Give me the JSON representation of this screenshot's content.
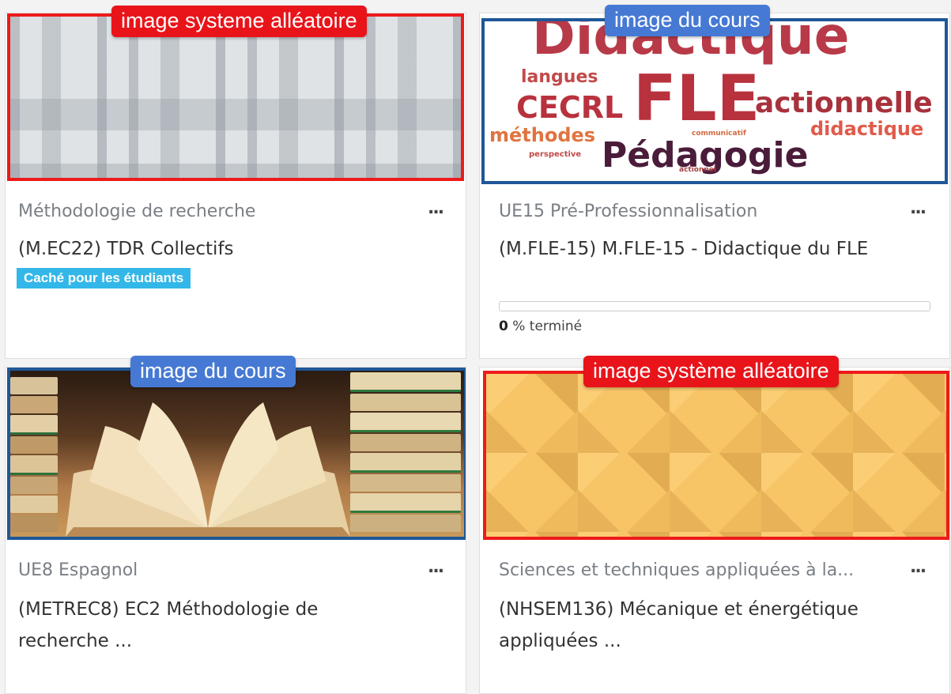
{
  "courses": [
    {
      "overlay_label": "image systeme alléatoire",
      "overlay_color": "#e8141a",
      "image_kind": "system-pattern",
      "category": "Méthodologie de recherche",
      "title": "(M.EC22) TDR Collectifs",
      "badge": "Caché pour les étudiants",
      "menu": "..."
    },
    {
      "overlay_label": "image du cours",
      "overlay_color": "#4679d3",
      "image_kind": "course-image",
      "category": "UE15 Pré-Professionnalisation",
      "title": "(M.FLE-15) M.FLE-15 - Didactique du FLE",
      "progress_percent": 0,
      "progress_value": "0",
      "progress_suffix": " % terminé",
      "menu": "...",
      "word_cloud": {
        "w1": "Didactique",
        "w2": "langues",
        "w3": "CECRL",
        "w4": "FLE",
        "w5": "actionnelle",
        "w6": "méthodes",
        "w7": "communicatif",
        "w8": "didactique",
        "w9": "perspective",
        "w10": "Pédagogie",
        "w11": "actionnel"
      }
    },
    {
      "overlay_label": "image du cours",
      "overlay_color": "#4679d3",
      "image_kind": "course-image",
      "category": "UE8 Espagnol",
      "title": "(METREC8) EC2 Méthodologie de recherche ...",
      "menu": "..."
    },
    {
      "overlay_label": "image système alléatoire",
      "overlay_color": "#e8141a",
      "image_kind": "system-pattern",
      "category": "Sciences et techniques appliquées à la...",
      "title": "(NHSEM136) Mécanique et énergétique appliquées ...",
      "menu": "..."
    }
  ]
}
